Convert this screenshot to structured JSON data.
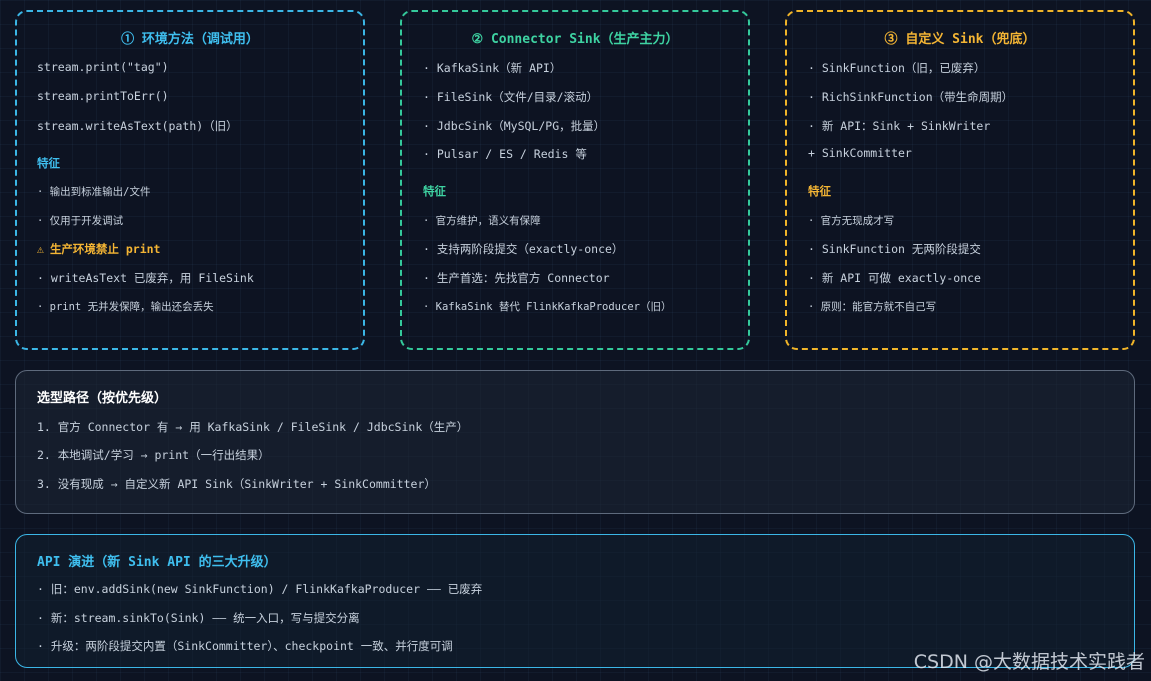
{
  "card1": {
    "title": "① 环境方法（调试用）",
    "lines": [
      "stream.print(\"tag\")",
      "stream.printToErr()",
      "stream.writeAsText(path)（旧）"
    ],
    "feature_label": "特征",
    "features": [
      "· 输出到标准输出/文件",
      "· 仅用于开发调试"
    ],
    "warning": "生产环境禁止 print",
    "notes": [
      "· writeAsText 已废弃，用 FileSink",
      "· print 无并发保障，输出还会丢失"
    ]
  },
  "card2": {
    "title": "② Connector Sink（生产主力）",
    "lines": [
      "· KafkaSink（新 API）",
      "· FileSink（文件/目录/滚动）",
      "· JdbcSink（MySQL/PG，批量）",
      "· Pulsar / ES / Redis 等"
    ],
    "feature_label": "特征",
    "features": [
      "· 官方维护，语义有保障",
      "· 支持两阶段提交（exactly-once）",
      "· 生产首选：先找官方 Connector",
      "· KafkaSink 替代 FlinkKafkaProducer（旧）"
    ]
  },
  "card3": {
    "title": "③ 自定义 Sink（兜底）",
    "lines": [
      "· SinkFunction（旧，已废弃）",
      "· RichSinkFunction（带生命周期）",
      "· 新 API：Sink + SinkWriter",
      "+ SinkCommitter"
    ],
    "feature_label": "特征",
    "features": [
      "· 官方无现成才写",
      "· SinkFunction 无两阶段提交",
      "· 新 API 可做 exactly-once",
      "· 原则：能官方就不自己写"
    ]
  },
  "selection": {
    "title": "选型路径（按优先级）",
    "items": [
      "1. 官方 Connector 有 → 用 KafkaSink / FileSink / JdbcSink（生产）",
      "2. 本地调试/学习 → print（一行出结果）",
      "3. 没有现成 → 自定义新 API Sink（SinkWriter + SinkCommitter）"
    ]
  },
  "evolution": {
    "title": "API 演进（新 Sink API 的三大升级）",
    "items": [
      "· 旧：env.addSink(new SinkFunction) / FlinkKafkaProducer —— 已废弃",
      "· 新：stream.sinkTo(Sink) —— 统一入口，写与提交分离",
      "· 升级：两阶段提交内置（SinkCommitter）、checkpoint 一致、并行度可调"
    ]
  },
  "watermark": "CSDN @大数据技术实践者",
  "colors": {
    "blue": "#3bb6e6",
    "green": "#34c99b",
    "yellow": "#f0b429",
    "background": "#0d1322"
  },
  "icons": {
    "warning": "warning-triangle-icon"
  }
}
